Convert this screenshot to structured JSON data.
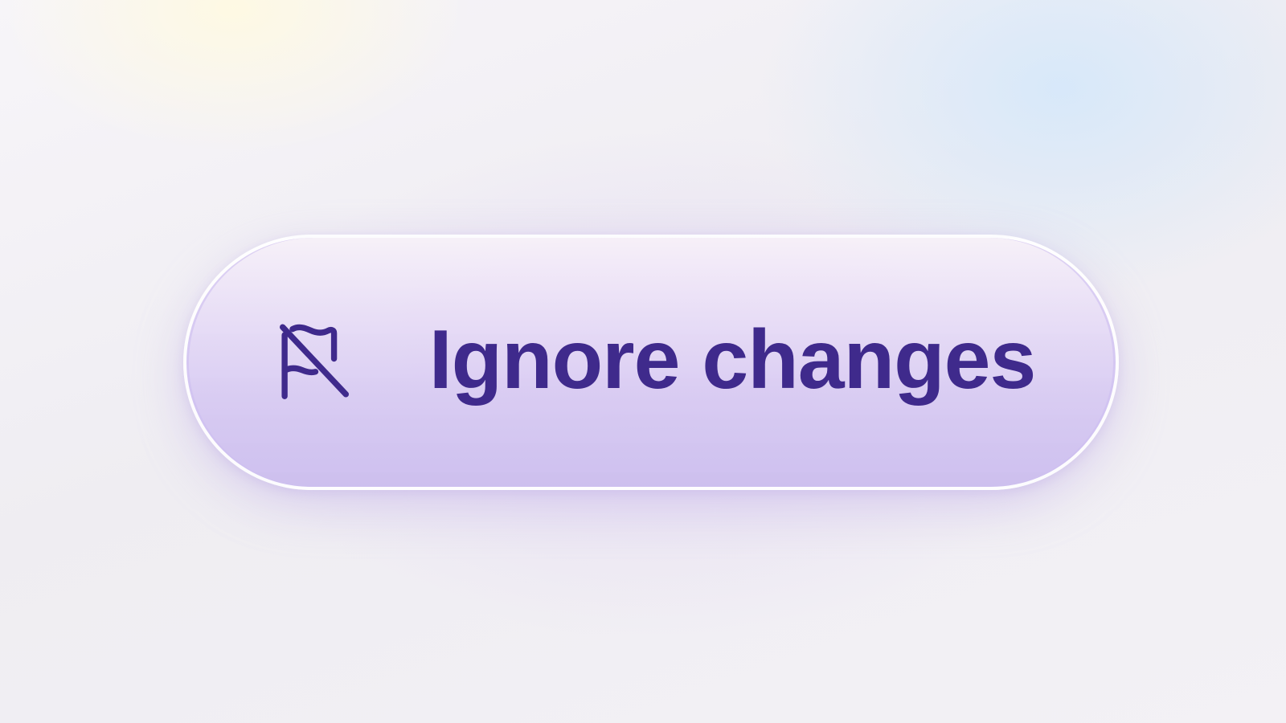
{
  "button": {
    "label": "Ignore changes",
    "icon": "flag-off-icon"
  },
  "colors": {
    "text": "#3f2a8c",
    "icon": "#3f2a8c",
    "button_fill_top": "#f6f0f8",
    "button_fill_bottom": "#ccbeee"
  }
}
